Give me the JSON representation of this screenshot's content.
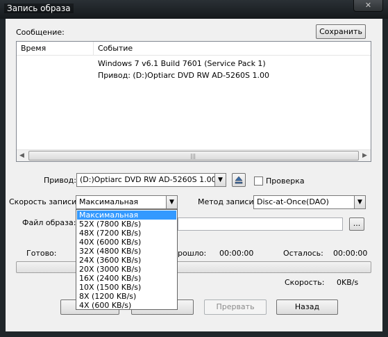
{
  "window": {
    "title": "Запись образа",
    "close_glyph": "✕"
  },
  "message_label": "Сообщение:",
  "save_button": "Сохранить",
  "log": {
    "columns": [
      "Время",
      "Событие"
    ],
    "rows": [
      {
        "time": "",
        "event": "Windows 7 v6.1 Build 7601 (Service Pack 1)"
      },
      {
        "time": "",
        "event": "Привод: (D:)Optiarc DVD RW AD-5260S 1.00"
      }
    ]
  },
  "drive": {
    "label": "Привод:",
    "value": "(D:)Optiarc DVD RW AD-5260S 1.00",
    "eject_icon": "eject-icon"
  },
  "verify": {
    "label": "Проверка",
    "checked": false
  },
  "speed": {
    "label": "Скорость записи:",
    "value": "Максимальная",
    "options": [
      "Максимальная",
      "52X (7800 KB/s)",
      "48X (7200 KB/s)",
      "40X (6000 KB/s)",
      "32X (4800 KB/s)",
      "24X (3600 KB/s)",
      "20X (3000 KB/s)",
      "16X (2400 KB/s)",
      "10X (1500 KB/s)",
      "8X (1200 KB/s)",
      "4X (600 KB/s)"
    ]
  },
  "method": {
    "label": "Метод записи:",
    "value": "Disc-at-Once(DAO)"
  },
  "image_file": {
    "label": "Файл образа:",
    "value": "",
    "browse": "..."
  },
  "status": {
    "ready_label": "Готово:",
    "elapsed_label": "рошло:",
    "elapsed_value": "00:00:00",
    "remaining_label": "Осталось:",
    "remaining_value": "00:00:00",
    "speed_label": "Скорость:",
    "speed_value": "0KB/s",
    "progress": 0
  },
  "buttons": {
    "abort": "Прервать",
    "back": "Назад"
  },
  "colors": {
    "selection": "#3399ff",
    "titlebar": "#1a1f22",
    "dialog": "#f0f0f0"
  }
}
